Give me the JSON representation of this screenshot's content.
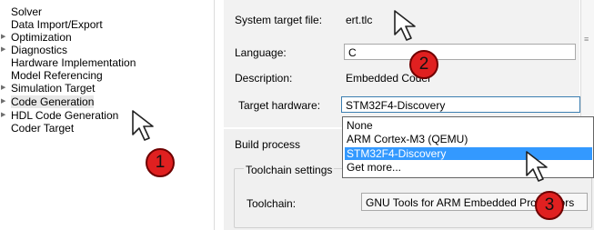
{
  "tree": {
    "items": [
      {
        "label": "Solver",
        "has_children": false,
        "selected": false
      },
      {
        "label": "Data Import/Export",
        "has_children": false,
        "selected": false
      },
      {
        "label": "Optimization",
        "has_children": true,
        "selected": false
      },
      {
        "label": "Diagnostics",
        "has_children": true,
        "selected": false
      },
      {
        "label": "Hardware Implementation",
        "has_children": false,
        "selected": false
      },
      {
        "label": "Model Referencing",
        "has_children": false,
        "selected": false
      },
      {
        "label": "Simulation Target",
        "has_children": true,
        "selected": false
      },
      {
        "label": "Code Generation",
        "has_children": true,
        "selected": true
      },
      {
        "label": "HDL Code Generation",
        "has_children": true,
        "selected": false
      },
      {
        "label": "Coder Target",
        "has_children": false,
        "selected": false
      }
    ]
  },
  "target": {
    "system_target_file_label": "System target file:",
    "system_target_file_value": "ert.tlc",
    "language_label": "Language:",
    "language_value": "C",
    "description_label": "Description:",
    "description_value": "Embedded Coder",
    "target_hardware_label": "Target hardware:",
    "target_hardware_value": "STM32F4-Discovery"
  },
  "dropdown": {
    "options": [
      "None",
      "ARM Cortex-M3 (QEMU)",
      "STM32F4-Discovery",
      "Get more..."
    ],
    "highlighted_index": 2
  },
  "build": {
    "group_label": "Build process",
    "toolchain_settings_label": "Toolchain settings",
    "toolchain_label": "Toolchain:",
    "toolchain_value": "GNU Tools for ARM Embedded Processors"
  },
  "annotations": {
    "step1": "1",
    "step2": "2",
    "step3": "3"
  },
  "colors": {
    "badge": "#e02020",
    "highlight": "#3399ff"
  }
}
